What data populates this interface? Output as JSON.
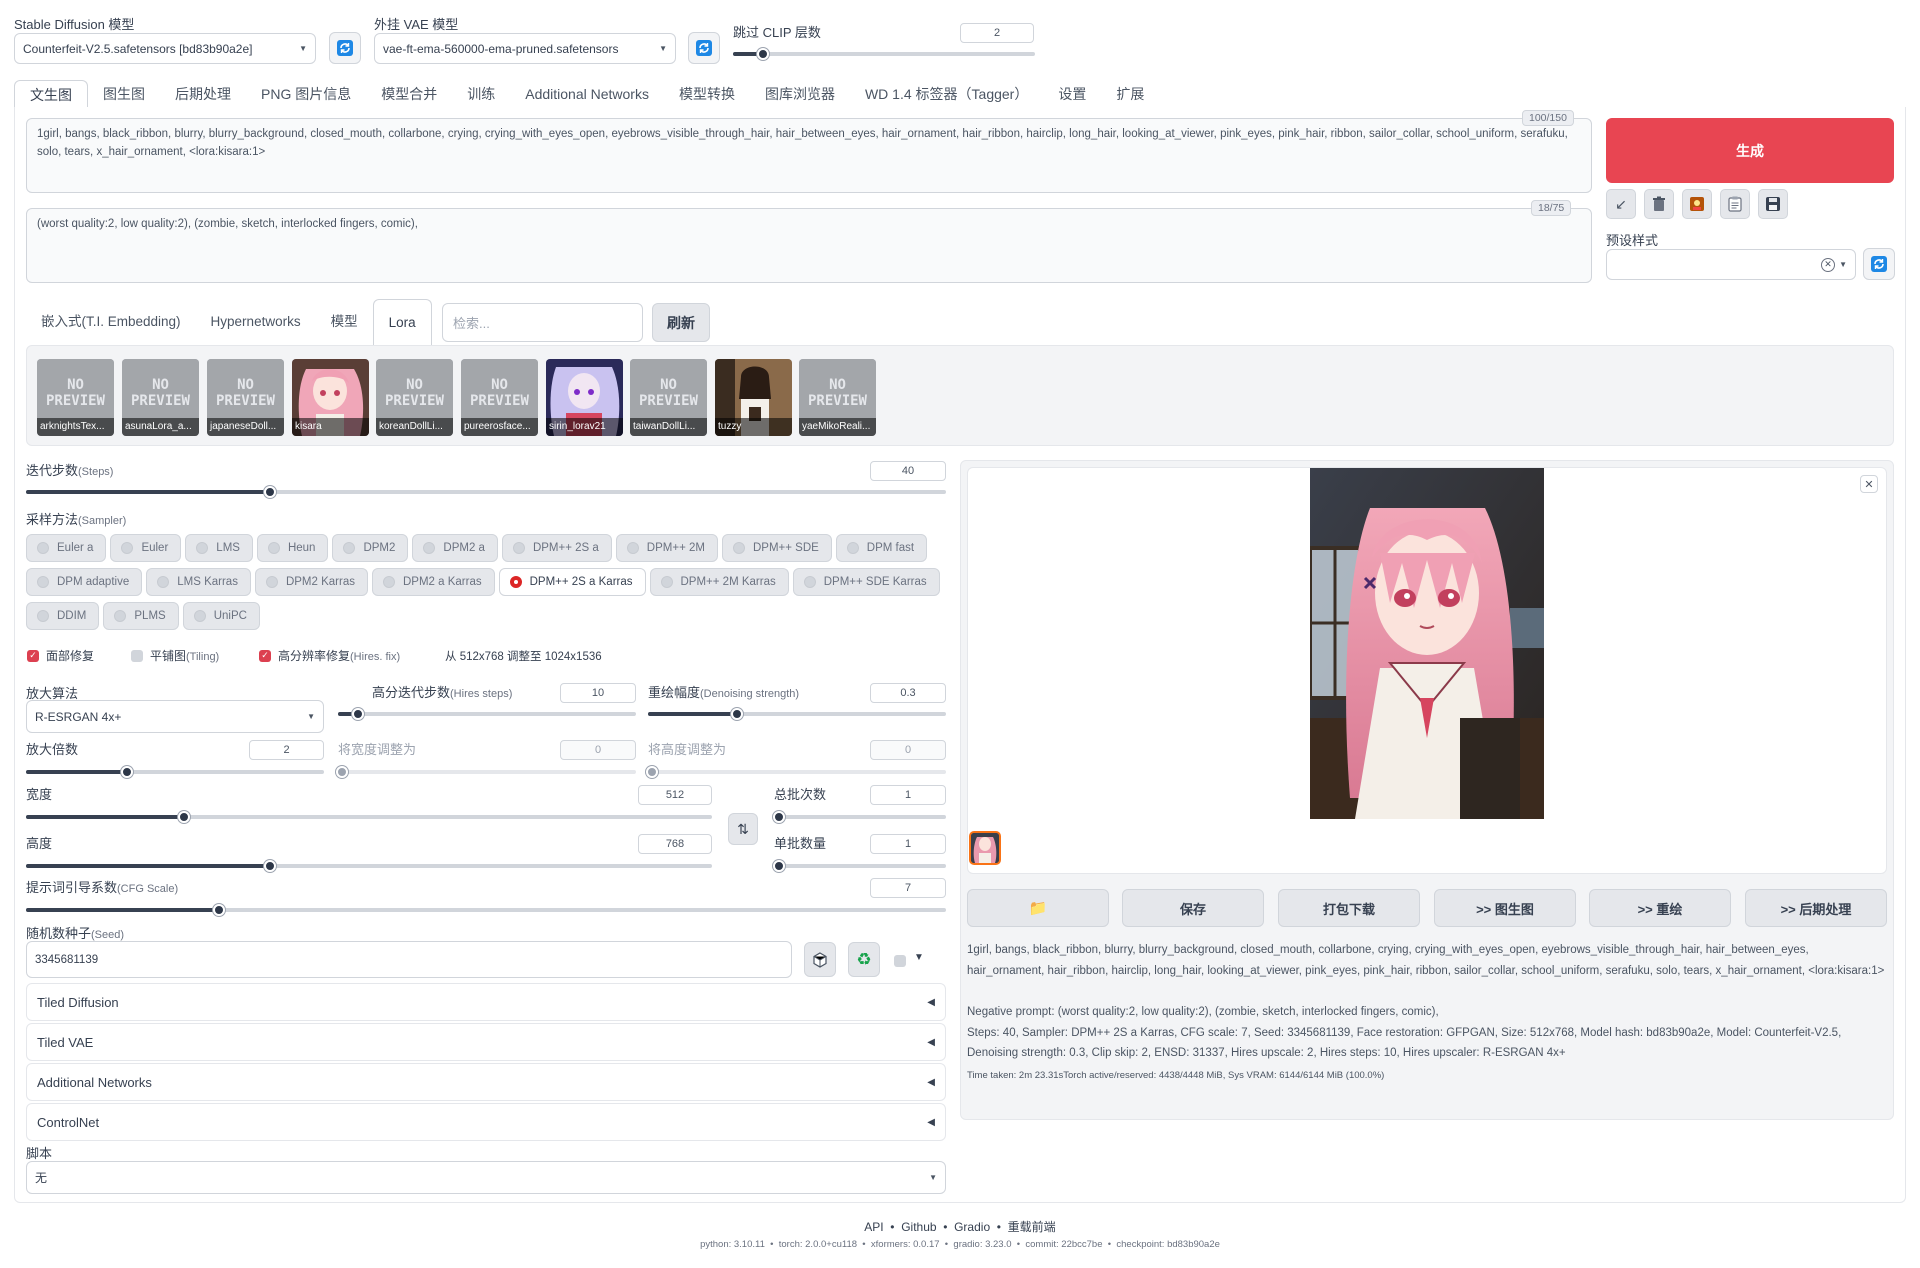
{
  "top": {
    "model_label": "Stable Diffusion 模型",
    "model_value": "Counterfeit-V2.5.safetensors [bd83b90a2e]",
    "vae_label": "外挂 VAE 模型",
    "vae_value": "vae-ft-ema-560000-ema-pruned.safetensors",
    "clip_label": "跳过 CLIP 层数",
    "clip_value": "2",
    "clip_fraction": 0.1
  },
  "main_tabs": [
    "文生图",
    "图生图",
    "后期处理",
    "PNG 图片信息",
    "模型合并",
    "训练",
    "Additional Networks",
    "模型转换",
    "图库浏览器",
    "WD 1.4 标签器（Tagger）",
    "设置",
    "扩展"
  ],
  "prompt": {
    "text": "1girl, bangs, black_ribbon, blurry, blurry_background, closed_mouth, collarbone, crying, crying_with_eyes_open, eyebrows_visible_through_hair, hair_between_eyes, hair_ornament, hair_ribbon, hairclip, long_hair, looking_at_viewer, pink_eyes, pink_hair, ribbon, sailor_collar, school_uniform, serafuku, solo, tears, x_hair_ornament, <lora:kisara:1>",
    "counter": "100/150"
  },
  "negative": {
    "text": "(worst quality:2, low quality:2), (zombie, sketch, interlocked fingers, comic),",
    "counter": "18/75"
  },
  "generate_label": "生成",
  "styles_label": "预设样式",
  "extra_tabs": [
    "嵌入式(T.I. Embedding)",
    "Hypernetworks",
    "模型",
    "Lora"
  ],
  "search_placeholder": "检索...",
  "refresh_label": "刷新",
  "placeholder_text": "NO\nPREVIEW",
  "lora_cards": [
    {
      "name": "arknightsTex..."
    },
    {
      "name": "asunaLora_a..."
    },
    {
      "name": "japaneseDoll..."
    },
    {
      "name": "kisara"
    },
    {
      "name": "koreanDollLi..."
    },
    {
      "name": "pureerosface..."
    },
    {
      "name": "sirin_lorav21"
    },
    {
      "name": "taiwanDollLi..."
    },
    {
      "name": "tuzzy"
    },
    {
      "name": "yaeMikoReali..."
    }
  ],
  "steps": {
    "label": "迭代步数",
    "sub": "(Steps)",
    "value": "40",
    "fraction": 0.265
  },
  "sampler": {
    "label": "采样方法",
    "sub": "(Sampler)",
    "options": [
      "Euler a",
      "Euler",
      "LMS",
      "Heun",
      "DPM2",
      "DPM2 a",
      "DPM++ 2S a",
      "DPM++ 2M",
      "DPM++ SDE",
      "DPM fast",
      "DPM adaptive",
      "LMS Karras",
      "DPM2 Karras",
      "DPM2 a Karras",
      "DPM++ 2S a Karras",
      "DPM++ 2M Karras",
      "DPM++ SDE Karras",
      "DDIM",
      "PLMS",
      "UniPC"
    ],
    "selected": "DPM++ 2S a Karras"
  },
  "checks": {
    "face": "面部修复",
    "tiling": "平铺图",
    "tiling_sub": "(Tiling)",
    "hires": "高分辨率修复",
    "hires_sub": "(Hires. fix)",
    "resize_note": "从 512x768 调整至 1024x1536"
  },
  "upscaler": {
    "label": "放大算法",
    "value": "R-ESRGAN 4x+"
  },
  "hires_steps": {
    "label": "高分迭代步数",
    "sub": "(Hires steps)",
    "value": "10",
    "fraction": 0.066
  },
  "denoise": {
    "label": "重绘幅度",
    "sub": "(Denoising strength)",
    "value": "0.3",
    "fraction": 0.3
  },
  "upscale_by": {
    "label": "放大倍数",
    "value": "2",
    "fraction": 0.34
  },
  "resize_w": {
    "label": "将宽度调整为",
    "value": "0"
  },
  "resize_h": {
    "label": "将高度调整为",
    "value": "0"
  },
  "width": {
    "label": "宽度",
    "value": "512",
    "fraction": 0.23
  },
  "height": {
    "label": "高度",
    "value": "768",
    "fraction": 0.355
  },
  "batch_count": {
    "label": "总批次数",
    "value": "1"
  },
  "batch_size": {
    "label": "单批数量",
    "value": "1"
  },
  "cfg": {
    "label": "提示词引导系数",
    "sub": "(CFG Scale)",
    "value": "7",
    "fraction": 0.21
  },
  "seed": {
    "label": "随机数种子",
    "sub": "(Seed)",
    "value": "3345681139"
  },
  "accordions": [
    "Tiled Diffusion",
    "Tiled VAE",
    "Additional Networks",
    "ControlNet"
  ],
  "script": {
    "label": "脚本",
    "value": "无"
  },
  "output_buttons": [
    "保存",
    "打包下载",
    ">> 图生图",
    ">> 重绘",
    ">> 后期处理"
  ],
  "info": {
    "prompt": "1girl, bangs, black_ribbon, blurry, blurry_background, closed_mouth, collarbone, crying, crying_with_eyes_open, eyebrows_visible_through_hair, hair_between_eyes, hair_ornament, hair_ribbon, hairclip, long_hair, looking_at_viewer, pink_eyes, pink_hair, ribbon, sailor_collar, school_uniform, serafuku, solo, tears, x_hair_ornament, <lora:kisara:1>",
    "negative": "Negative prompt: (worst quality:2, low quality:2), (zombie, sketch, interlocked fingers, comic),",
    "params": "Steps: 40, Sampler: DPM++ 2S a Karras, CFG scale: 7, Seed: 3345681139, Face restoration: GFPGAN, Size: 512x768, Model hash: bd83b90a2e, Model: Counterfeit-V2.5, Denoising strength: 0.3, Clip skip: 2, ENSD: 31337, Hires upscale: 2, Hires steps: 10, Hires upscaler: R-ESRGAN 4x+",
    "time": "Time taken: 2m 23.31sTorch active/reserved: 4438/4448 MiB, Sys VRAM: 6144/6144 MiB (100.0%)"
  },
  "footer": {
    "links": [
      "API",
      "Github",
      "Gradio",
      "重载前端"
    ],
    "versions": "python: 3.10.11  •  torch: 2.0.0+cu118  •  xformers: 0.0.17  •  gradio: 3.23.0  •  commit: 22bcc7be  •  checkpoint: bd83b90a2e"
  },
  "colors": {
    "accent": "#e84552",
    "selected_radio": "#dc2626",
    "checkbox": "#dc4050",
    "thumb_border": "#f97316"
  }
}
